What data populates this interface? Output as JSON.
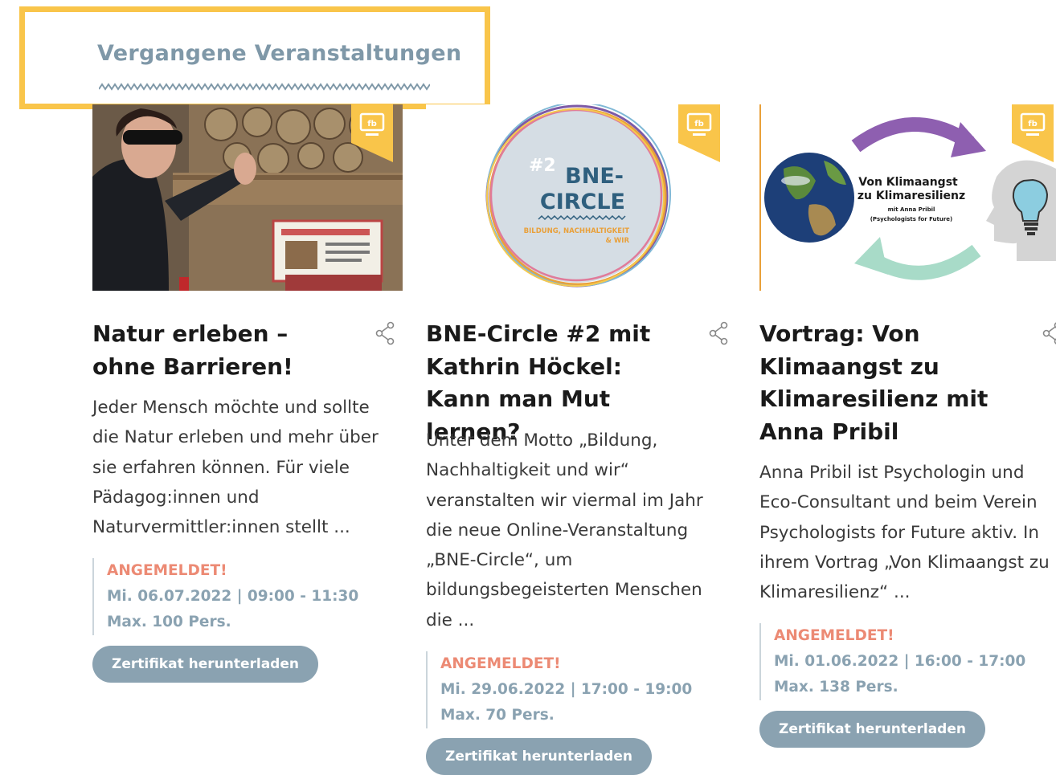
{
  "section": {
    "title": "Vergangene Veranstaltungen",
    "highlight_color": "#f9c54a",
    "title_color": "#7f98a8"
  },
  "badge_icon": "fb-screen-icon",
  "events": [
    {
      "image": "person-touching-insect-hotel-photo",
      "title": "Natur erleben – ohne Barrieren!",
      "description": "Jeder Mensch möchte und sollte die Natur erleben und mehr über sie erfahren können. Für viele Pädagog:innen und Naturvermittler:innen stellt ...",
      "status": "ANGEMELDET!",
      "date_time": "Mi. 06.07.2022 | 09:00 - 11:30",
      "capacity": "Max. 100 Pers.",
      "button": "Zertifikat herunterladen"
    },
    {
      "image": "bne-circle-logo",
      "image_text": {
        "number": "#2",
        "line1": "BNE-",
        "line2": "CIRCLE",
        "subtitle1": "BILDUNG, NACHHALTIGKEIT",
        "subtitle2": "& WIR"
      },
      "title": "BNE-Circle #2 mit Kathrin Höckel: Kann man Mut lernen?",
      "description": "Unter dem Motto „Bildung, Nachhaltigkeit und wir“ veranstalten wir viermal im Jahr die neue Online-Veranstaltung „BNE-Circle“, um bildungsbegeisterten Menschen die ...",
      "status": "ANGEMELDET!",
      "date_time": "Mi. 29.06.2022 | 17:00 - 19:00",
      "capacity": "Max. 70 Pers.",
      "button": "Zertifikat herunterladen"
    },
    {
      "image": "earth-arrows-head-lightbulb-graphic",
      "image_text": {
        "line1": "Von Klimaangst",
        "line2": "zu Klimaresilienz",
        "line3": "mit Anna Pribil",
        "line4": "(Psychologists for Future)"
      },
      "title": "Vortrag: Von Klimaangst zu Klimaresilienz mit Anna Pribil",
      "description": "Anna Pribil ist Psychologin und Eco-Consultant und beim Verein Psychologists for Future aktiv. In ihrem Vortrag „Von Klimaangst zu Klimaresilienz“ ...",
      "status": "ANGEMELDET!",
      "date_time": "Mi. 01.06.2022 | 16:00 - 17:00",
      "capacity": "Max. 138 Pers.",
      "button": "Zertifikat herunterladen"
    }
  ],
  "colors": {
    "status": "#ec8a74",
    "meta": "#8aa2b1",
    "button_bg": "#8aa2b1",
    "badge": "#f9c54a"
  }
}
